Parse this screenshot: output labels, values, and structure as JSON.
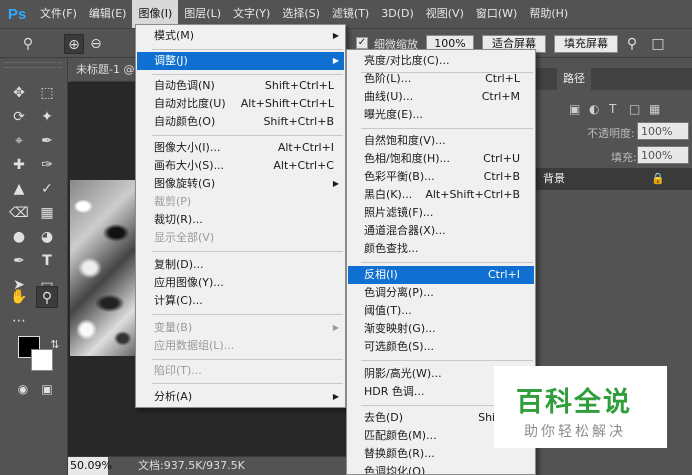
{
  "app": {
    "logo": "Ps"
  },
  "menubar": {
    "items": [
      "文件(F)",
      "编辑(E)",
      "图像(I)",
      "图层(L)",
      "文字(Y)",
      "选择(S)",
      "滤镜(T)",
      "3D(D)",
      "视图(V)",
      "窗口(W)",
      "帮助(H)"
    ],
    "active_index": 2
  },
  "options_bar": {
    "scrubby_zoom_label": "细微缩放",
    "zoom_value": "100%",
    "fit_screen_label": "适合屏幕",
    "fill_screen_label": "填充屏幕"
  },
  "document": {
    "tab_title": "未标题-1 @",
    "zoom": "50.09%",
    "info": "文档:937.5K/937.5K"
  },
  "panel": {
    "tabs": [
      "路径"
    ],
    "opacity_label": "不透明度:",
    "opacity_value": "100%",
    "fill_label": "填充:",
    "fill_value": "100%",
    "layer_name": "背景"
  },
  "image_menu": {
    "items": [
      {
        "label": "模式(M)",
        "shortcut": "",
        "submenu": true,
        "disabled": false
      },
      {
        "label": "调整(J)",
        "shortcut": "",
        "submenu": true,
        "disabled": false,
        "highlighted": true
      },
      {
        "label": "自动色调(N)",
        "shortcut": "Shift+Ctrl+L",
        "submenu": false,
        "disabled": false
      },
      {
        "label": "自动对比度(U)",
        "shortcut": "Alt+Shift+Ctrl+L",
        "submenu": false,
        "disabled": false
      },
      {
        "label": "自动颜色(O)",
        "shortcut": "Shift+Ctrl+B",
        "submenu": false,
        "disabled": false
      },
      {
        "label": "图像大小(I)...",
        "shortcut": "Alt+Ctrl+I",
        "submenu": false,
        "disabled": false
      },
      {
        "label": "画布大小(S)...",
        "shortcut": "Alt+Ctrl+C",
        "submenu": false,
        "disabled": false
      },
      {
        "label": "图像旋转(G)",
        "shortcut": "",
        "submenu": true,
        "disabled": false
      },
      {
        "label": "裁剪(P)",
        "shortcut": "",
        "submenu": false,
        "disabled": true
      },
      {
        "label": "裁切(R)...",
        "shortcut": "",
        "submenu": false,
        "disabled": false
      },
      {
        "label": "显示全部(V)",
        "shortcut": "",
        "submenu": false,
        "disabled": true
      },
      {
        "label": "复制(D)...",
        "shortcut": "",
        "submenu": false,
        "disabled": false
      },
      {
        "label": "应用图像(Y)...",
        "shortcut": "",
        "submenu": false,
        "disabled": false
      },
      {
        "label": "计算(C)...",
        "shortcut": "",
        "submenu": false,
        "disabled": false
      },
      {
        "label": "变量(B)",
        "shortcut": "",
        "submenu": true,
        "disabled": true
      },
      {
        "label": "应用数据组(L)...",
        "shortcut": "",
        "submenu": false,
        "disabled": true
      },
      {
        "label": "陷印(T)...",
        "shortcut": "",
        "submenu": false,
        "disabled": true
      },
      {
        "label": "分析(A)",
        "shortcut": "",
        "submenu": true,
        "disabled": false
      }
    ]
  },
  "adjust_menu": {
    "items": [
      {
        "label": "亮度/对比度(C)...",
        "shortcut": ""
      },
      {
        "label": "色阶(L)...",
        "shortcut": "Ctrl+L"
      },
      {
        "label": "曲线(U)...",
        "shortcut": "Ctrl+M"
      },
      {
        "label": "曝光度(E)...",
        "shortcut": ""
      },
      {
        "label": "自然饱和度(V)...",
        "shortcut": ""
      },
      {
        "label": "色相/饱和度(H)...",
        "shortcut": "Ctrl+U"
      },
      {
        "label": "色彩平衡(B)...",
        "shortcut": "Ctrl+B"
      },
      {
        "label": "黑白(K)...",
        "shortcut": "Alt+Shift+Ctrl+B"
      },
      {
        "label": "照片滤镜(F)...",
        "shortcut": ""
      },
      {
        "label": "通道混合器(X)...",
        "shortcut": ""
      },
      {
        "label": "颜色查找...",
        "shortcut": ""
      },
      {
        "label": "反相(I)",
        "shortcut": "Ctrl+I",
        "highlighted": true
      },
      {
        "label": "色调分离(P)...",
        "shortcut": ""
      },
      {
        "label": "阈值(T)...",
        "shortcut": ""
      },
      {
        "label": "渐变映射(G)...",
        "shortcut": ""
      },
      {
        "label": "可选颜色(S)...",
        "shortcut": ""
      },
      {
        "label": "阴影/高光(W)...",
        "shortcut": ""
      },
      {
        "label": "HDR 色调...",
        "shortcut": ""
      },
      {
        "label": "去色(D)",
        "shortcut": "Shift+C"
      },
      {
        "label": "匹配颜色(M)...",
        "shortcut": ""
      },
      {
        "label": "替换颜色(R)...",
        "shortcut": ""
      },
      {
        "label": "色调均化(Q)",
        "shortcut": ""
      }
    ]
  },
  "watermark": {
    "title": "百科全说",
    "subtitle": "助你轻松解决"
  },
  "colors": {
    "ui_bg": "#535353",
    "menu_bg": "#f0f0f0",
    "highlight": "#0f70d1",
    "ps_blue": "#31a8ff",
    "watermark_green": "#2f9e3b"
  }
}
